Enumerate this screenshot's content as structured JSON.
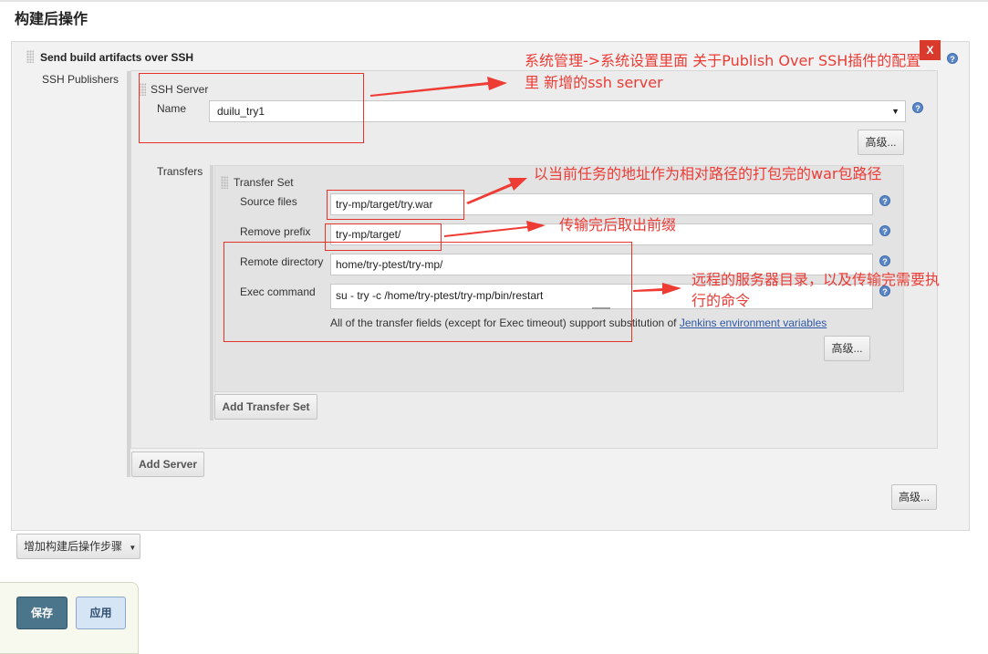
{
  "section": {
    "title": "构建后操作"
  },
  "plugin": {
    "title": "Send build artifacts over SSH",
    "close_label": "X"
  },
  "ssh_publishers_label": "SSH Publishers",
  "ssh_server": {
    "header": "SSH Server",
    "name_label": "Name",
    "name_value": "duilu_try1",
    "advanced_label": "高级..."
  },
  "transfers": {
    "label": "Transfers",
    "set_header": "Transfer Set",
    "source_files_label": "Source files",
    "source_files_value": "try-mp/target/try.war",
    "remove_prefix_label": "Remove prefix",
    "remove_prefix_value": "try-mp/target/",
    "remote_directory_label": "Remote directory",
    "remote_directory_value": "home/try-ptest/try-mp/",
    "exec_command_label": "Exec command",
    "exec_command_value": "su - try -c /home/try-ptest/try-mp/bin/restart",
    "note_text": "All of the transfer fields (except for Exec timeout) support substitution of ",
    "note_link": "Jenkins environment variables",
    "advanced_label": "高级...",
    "add_transfer_set_label": "Add Transfer Set"
  },
  "add_server_label": "Add Server",
  "plugin_advanced_label": "高级...",
  "add_step_label": "增加构建后操作步骤",
  "footer": {
    "save_label": "保存",
    "apply_label": "应用"
  },
  "annotations": {
    "server_note_line1": "系统管理->系统设置里面 关于Publish Over SSH插件的配置",
    "server_note_line2": "里 新增的ssh server",
    "source_note": "以当前任务的地址作为相对路径的打包完的war包路径",
    "prefix_note": "传输完后取出前缀",
    "remote_note_line1": "远程的服务器目录，以及传输完需要执",
    "remote_note_line2": "行的命令"
  },
  "colors": {
    "annotation_red": "#e5332a",
    "save_bg": "#4b758b",
    "close_bg": "#d93a2b",
    "help_blue": "#5b86c5"
  },
  "icons": [
    "help-icon",
    "grip-icon",
    "dropdown-caret-icon",
    "close-icon"
  ]
}
